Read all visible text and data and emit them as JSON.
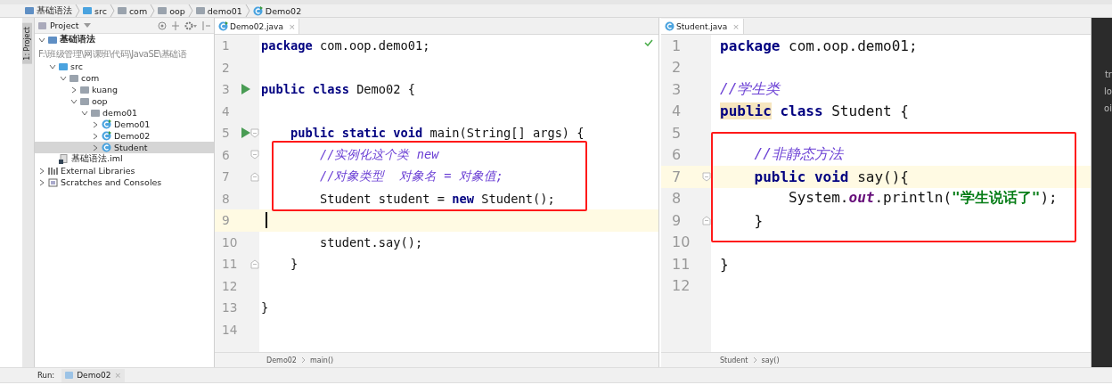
{
  "breadcrumbs": [
    {
      "label": "基础语法",
      "kind": "module"
    },
    {
      "label": "src",
      "kind": "source"
    },
    {
      "label": "com",
      "kind": "package"
    },
    {
      "label": "oop",
      "kind": "package"
    },
    {
      "label": "demo01",
      "kind": "package"
    },
    {
      "label": "Demo02",
      "kind": "run-class"
    }
  ],
  "side_tab": "1: Project",
  "project": {
    "title": "Project",
    "tree": [
      {
        "label": "基础语法",
        "path": "F:\\班级管理\\网课班\\代码\\JavaSE\\基础语",
        "kind": "module",
        "expanded": true,
        "selected": false,
        "children": [
          {
            "label": "src",
            "kind": "source",
            "expanded": true,
            "selected": false,
            "children": [
              {
                "label": "com",
                "kind": "package",
                "expanded": true,
                "selected": false,
                "children": [
                  {
                    "label": "kuang",
                    "kind": "package",
                    "expanded": false,
                    "selected": false
                  },
                  {
                    "label": "oop",
                    "kind": "package",
                    "expanded": true,
                    "selected": false,
                    "children": [
                      {
                        "label": "demo01",
                        "kind": "package",
                        "expanded": true,
                        "selected": false,
                        "children": [
                          {
                            "label": "Demo01",
                            "kind": "run-class",
                            "expanded": false,
                            "selected": false
                          },
                          {
                            "label": "Demo02",
                            "kind": "run-class",
                            "expanded": false,
                            "selected": false
                          },
                          {
                            "label": "Student",
                            "kind": "class",
                            "expanded": false,
                            "selected": true
                          }
                        ]
                      }
                    ]
                  }
                ]
              }
            ]
          },
          {
            "label": "基础语法.iml",
            "kind": "file",
            "selected": false
          }
        ]
      },
      {
        "label": "External Libraries",
        "kind": "library",
        "expanded": false,
        "selected": false
      },
      {
        "label": "Scratches and Consoles",
        "kind": "scratches",
        "expanded": false,
        "selected": false
      }
    ]
  },
  "editors": [
    {
      "tab": "Demo02.java",
      "kind": "run-class",
      "close": "×",
      "breadcrumbs": [
        "Demo02",
        "main()"
      ],
      "lines": [
        {
          "number": "1",
          "current": false,
          "boxed": false,
          "run": false,
          "tokens": [
            {
              "kind": "keyword",
              "text": "package"
            },
            {
              "kind": "plain",
              "text": " com.oop.demo01;"
            }
          ]
        },
        {
          "number": "2",
          "current": false,
          "boxed": false,
          "run": false
        },
        {
          "number": "3",
          "current": false,
          "boxed": false,
          "run": true,
          "tokens": [
            {
              "kind": "keyword",
              "text": "public class"
            },
            {
              "kind": "plain",
              "text": " Demo02 {"
            }
          ]
        },
        {
          "number": "4",
          "current": false,
          "boxed": false,
          "run": false
        },
        {
          "number": "5",
          "current": false,
          "boxed": false,
          "run": true,
          "fold_start": true,
          "tokens": [
            {
              "kind": "keyword",
              "text": "    public static void"
            },
            {
              "kind": "plain",
              "text": " main(String[] args) {"
            }
          ]
        },
        {
          "number": "6",
          "current": false,
          "boxed": true,
          "run": false,
          "fold_start": true,
          "tokens": [
            {
              "kind": "comment",
              "text": "        //实例化这个类 new"
            }
          ]
        },
        {
          "number": "7",
          "current": false,
          "boxed": true,
          "run": false,
          "fold_end": true,
          "tokens": [
            {
              "kind": "comment",
              "text": "        //对象类型  对象名 = 对象值;"
            }
          ]
        },
        {
          "number": "8",
          "current": false,
          "boxed": true,
          "run": false,
          "tokens": [
            {
              "kind": "plain",
              "text": "        Student student = "
            },
            {
              "kind": "keyword",
              "text": "new"
            },
            {
              "kind": "plain",
              "text": " Student();"
            }
          ]
        },
        {
          "number": "9",
          "current": true,
          "boxed": false,
          "run": false,
          "caret": true
        },
        {
          "number": "10",
          "current": false,
          "boxed": false,
          "run": false,
          "tokens": [
            {
              "kind": "plain",
              "text": "        student.say();"
            }
          ]
        },
        {
          "number": "11",
          "current": false,
          "boxed": false,
          "run": false,
          "fold_end": true,
          "tokens": [
            {
              "kind": "plain",
              "text": "    }"
            }
          ]
        },
        {
          "number": "12",
          "current": false,
          "boxed": false,
          "run": false
        },
        {
          "number": "13",
          "current": false,
          "boxed": false,
          "run": false,
          "tokens": [
            {
              "kind": "plain",
              "text": "}"
            }
          ]
        },
        {
          "number": "14",
          "current": false,
          "boxed": false,
          "run": false
        }
      ]
    },
    {
      "tab": "Student.java",
      "kind": "class",
      "close": "×",
      "breadcrumbs": [
        "Student",
        "say()"
      ],
      "lines": [
        {
          "number": "1",
          "current": false,
          "boxed": false,
          "tokens": [
            {
              "kind": "keyword",
              "text": "package"
            },
            {
              "kind": "plain",
              "text": " com.oop.demo01;"
            }
          ]
        },
        {
          "number": "2",
          "current": false,
          "boxed": false
        },
        {
          "number": "3",
          "current": false,
          "boxed": false,
          "tokens": [
            {
              "kind": "comment",
              "text": "//学生类"
            }
          ]
        },
        {
          "number": "4",
          "current": false,
          "boxed": false,
          "tokens": [
            {
              "kind": "keyword-marked",
              "text": "public"
            },
            {
              "kind": "keyword",
              "text": " class"
            },
            {
              "kind": "plain",
              "text": " Student {"
            }
          ]
        },
        {
          "number": "5",
          "current": false,
          "boxed": false
        },
        {
          "number": "6",
          "current": false,
          "boxed": true,
          "tokens": [
            {
              "kind": "comment",
              "text": "    //非静态方法"
            }
          ]
        },
        {
          "number": "7",
          "current": true,
          "boxed": true,
          "fold_start": true,
          "tokens": [
            {
              "kind": "keyword",
              "text": "    public void"
            },
            {
              "kind": "plain",
              "text": " say(){"
            }
          ]
        },
        {
          "number": "8",
          "current": false,
          "boxed": true,
          "tokens": [
            {
              "kind": "plain",
              "text": "        System."
            },
            {
              "kind": "field",
              "text": "out"
            },
            {
              "kind": "plain",
              "text": ".println("
            },
            {
              "kind": "string",
              "text": "\"学生说话了\""
            },
            {
              "kind": "plain",
              "text": ");"
            }
          ]
        },
        {
          "number": "9",
          "current": false,
          "boxed": true,
          "fold_end": true,
          "tokens": [
            {
              "kind": "plain",
              "text": "    }"
            }
          ]
        },
        {
          "number": "10",
          "current": false,
          "boxed": false
        },
        {
          "number": "11",
          "current": false,
          "boxed": false,
          "tokens": [
            {
              "kind": "plain",
              "text": "}"
            }
          ]
        },
        {
          "number": "12",
          "current": false,
          "boxed": false
        }
      ]
    }
  ],
  "right_panel": [
    "tr",
    "lo",
    "oi"
  ],
  "run_bar": {
    "label": "Run:",
    "tab": "Demo02",
    "close": "×"
  }
}
